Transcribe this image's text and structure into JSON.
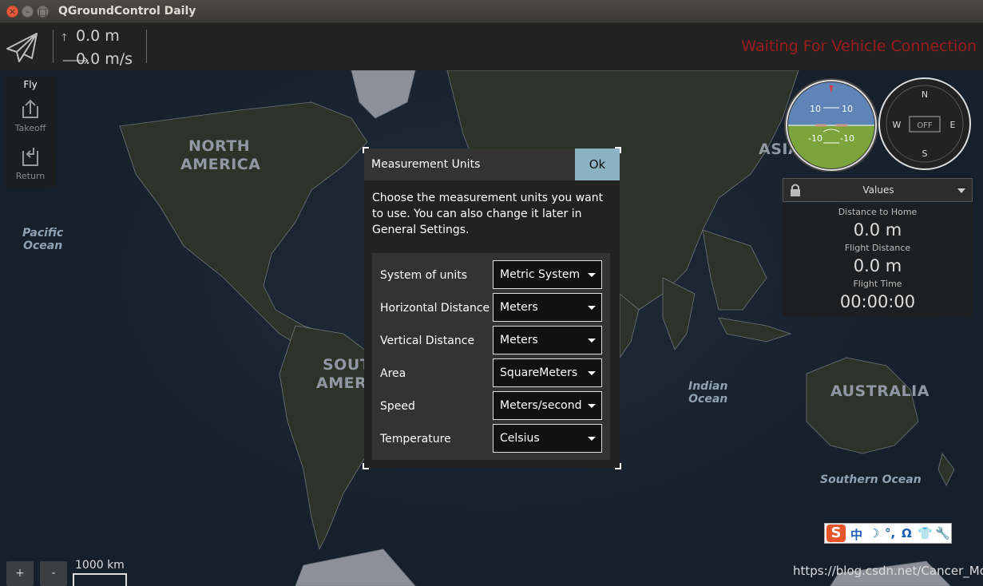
{
  "window": {
    "title": "QGroundControl Daily"
  },
  "toolbar": {
    "altitude": "0.0 m",
    "speed": "0.0 m/s",
    "status": "Waiting For Vehicle Connection",
    "status_color": "#9e1b1b"
  },
  "fly_tools": {
    "header": "Fly",
    "items": [
      {
        "label": "Takeoff",
        "icon": "takeoff-icon"
      },
      {
        "label": "Return",
        "icon": "return-icon"
      }
    ]
  },
  "map": {
    "labels": [
      "NORTH",
      "AMERICA",
      "SOUT",
      "AMER",
      "ASIA",
      "AUSTRALIA"
    ],
    "oceans": [
      "Pacific",
      "Ocean",
      "Indian",
      "Ocean",
      "Southern Ocean"
    ],
    "zoom_in": "+",
    "zoom_out": "-",
    "scale": "1000 km"
  },
  "attitude": {
    "pitch_top_left": "10",
    "pitch_top_right": "10",
    "pitch_bottom_left": "-10",
    "pitch_bottom_right": "-10"
  },
  "compass": {
    "n": "N",
    "e": "E",
    "s": "S",
    "w": "W",
    "state": "OFF"
  },
  "values_panel": {
    "header": "Values",
    "items": [
      {
        "label": "Distance to Home",
        "value": "0.0 m"
      },
      {
        "label": "Flight Distance",
        "value": "0.0 m"
      },
      {
        "label": "Flight Time",
        "value": "00:00:00"
      }
    ]
  },
  "dialog": {
    "title": "Measurement Units",
    "ok": "Ok",
    "description": "Choose the measurement units you want to use. You can also change it later in General Settings.",
    "rows": [
      {
        "label": "System of units",
        "value": "Metric System"
      },
      {
        "label": "Horizontal Distance",
        "value": "Meters"
      },
      {
        "label": "Vertical Distance",
        "value": "Meters"
      },
      {
        "label": "Area",
        "value": "SquareMeters"
      },
      {
        "label": "Speed",
        "value": "Meters/second"
      },
      {
        "label": "Temperature",
        "value": "Celsius"
      }
    ]
  },
  "ime_bar": {
    "logo": "S",
    "items": [
      "中",
      "☽",
      "°,",
      "Ω",
      "👕",
      "🔧"
    ]
  },
  "watermark": "https://blog.csdn.net/Cancer_Mo"
}
